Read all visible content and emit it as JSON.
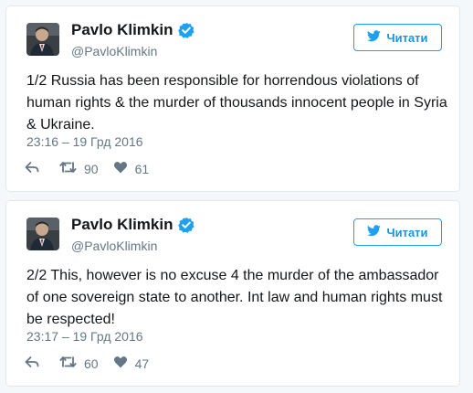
{
  "colors": {
    "background": "#f5f8fa",
    "accent": "#1da1f2",
    "secondary_text": "#657786"
  },
  "tweets": [
    {
      "author_name": "Pavlo Klimkin",
      "handle": "@PavloKlimkin",
      "verified": true,
      "follow_label": "Читати",
      "text": "1/2 Russia has been responsible for horrendous violations of human rights & the murder of thousands innocent people in Syria & Ukraine.",
      "timestamp": "23:16 – 19 Грд 2016",
      "retweets": "90",
      "likes": "61",
      "icons": [
        "reply-icon",
        "retweet-icon",
        "heart-icon",
        "twitter-bird-icon",
        "verified-badge-icon"
      ]
    },
    {
      "author_name": "Pavlo Klimkin",
      "handle": "@PavloKlimkin",
      "verified": true,
      "follow_label": "Читати",
      "text": "2/2 This, however is no excuse 4 the murder of the ambassador of one sovereign state to another. Int law and human rights must be respected!",
      "timestamp": "23:17 – 19 Грд 2016",
      "retweets": "60",
      "likes": "47",
      "icons": [
        "reply-icon",
        "retweet-icon",
        "heart-icon",
        "twitter-bird-icon",
        "verified-badge-icon"
      ]
    }
  ]
}
